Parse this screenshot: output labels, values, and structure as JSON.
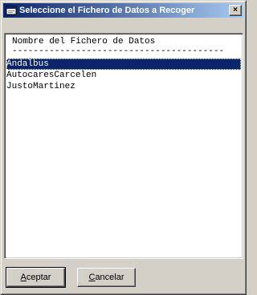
{
  "window": {
    "title": "Seleccione el Fichero de Datos a Recoger",
    "close_glyph": "×"
  },
  "list": {
    "header": "Nombre del Fichero de Datos",
    "separator": "----------------------------------------",
    "items": [
      "Andalbus",
      "AutocaresCarcelen",
      "JustoMartinez"
    ],
    "selected_index": 0
  },
  "buttons": {
    "accept_label": "Aceptar",
    "cancel_label": "Cancelar"
  },
  "colors": {
    "title_gradient_start": "#0a246a",
    "title_gradient_end": "#a6caf0",
    "selection": "#0a246a",
    "face": "#d4d0c8"
  },
  "icons": {
    "title": "app-window-icon",
    "close": "close-icon"
  }
}
